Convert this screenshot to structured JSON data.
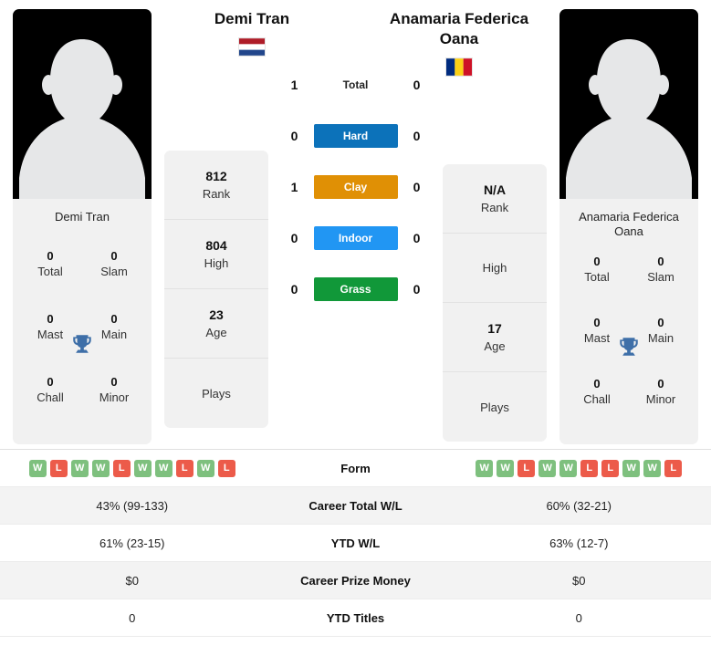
{
  "players": {
    "left": {
      "name": "Demi Tran",
      "card_name": "Demi Tran",
      "flag": "netherlands-flag",
      "flag_colors": [
        "#AE1C28",
        "#FFFFFF",
        "#21468B"
      ],
      "rank": "812",
      "rank_label": "Rank",
      "high": "804",
      "high_label": "High",
      "age": "23",
      "age_label": "Age",
      "plays": "",
      "plays_label": "Plays",
      "awards": [
        {
          "value": "0",
          "label": "Total"
        },
        {
          "value": "0",
          "label": "Slam"
        },
        {
          "value": "0",
          "label": "Mast"
        },
        {
          "value": "0",
          "label": "Main"
        },
        {
          "value": "0",
          "label": "Chall"
        },
        {
          "value": "0",
          "label": "Minor"
        }
      ],
      "form": [
        "W",
        "L",
        "W",
        "W",
        "L",
        "W",
        "W",
        "L",
        "W",
        "L"
      ],
      "career_total_wl": "43% (99-133)",
      "ytd_wl": "61% (23-15)",
      "career_prize_money": "$0",
      "ytd_titles": "0"
    },
    "right": {
      "name": "Anamaria Federica Oana",
      "card_name": "Anamaria Federica Oana",
      "flag": "romania-flag",
      "flag_colors": [
        "#002B7F",
        "#FCD116",
        "#CE1126"
      ],
      "rank": "N/A",
      "rank_label": "Rank",
      "high": "",
      "high_label": "High",
      "age": "17",
      "age_label": "Age",
      "plays": "",
      "plays_label": "Plays",
      "awards": [
        {
          "value": "0",
          "label": "Total"
        },
        {
          "value": "0",
          "label": "Slam"
        },
        {
          "value": "0",
          "label": "Mast"
        },
        {
          "value": "0",
          "label": "Main"
        },
        {
          "value": "0",
          "label": "Chall"
        },
        {
          "value": "0",
          "label": "Minor"
        }
      ],
      "form": [
        "W",
        "W",
        "L",
        "W",
        "W",
        "L",
        "L",
        "W",
        "W",
        "L"
      ],
      "career_total_wl": "60% (32-21)",
      "ytd_wl": "63% (12-7)",
      "career_prize_money": "$0",
      "ytd_titles": "0"
    }
  },
  "head_to_head": [
    {
      "label": "Total",
      "left": "1",
      "right": "0",
      "style": "plain",
      "color": ""
    },
    {
      "label": "Hard",
      "left": "0",
      "right": "0",
      "style": "surface",
      "color": "#0c72ba"
    },
    {
      "label": "Clay",
      "left": "1",
      "right": "0",
      "style": "surface",
      "color": "#e09005"
    },
    {
      "label": "Indoor",
      "left": "0",
      "right": "0",
      "style": "surface",
      "color": "#2196f3"
    },
    {
      "label": "Grass",
      "left": "0",
      "right": "0",
      "style": "surface",
      "color": "#119839"
    }
  ],
  "comparison_rows": [
    {
      "label": "Form",
      "type": "form"
    },
    {
      "label": "Career Total W/L",
      "type": "text",
      "key": "career_total_wl"
    },
    {
      "label": "YTD W/L",
      "type": "text",
      "key": "ytd_wl"
    },
    {
      "label": "Career Prize Money",
      "type": "text",
      "key": "career_prize_money"
    },
    {
      "label": "YTD Titles",
      "type": "text",
      "key": "ytd_titles"
    }
  ],
  "icons": {
    "trophy": "trophy-icon",
    "avatar": "avatar-placeholder-icon"
  },
  "colors": {
    "win": "#7ec07e",
    "loss": "#ec5b4a",
    "card_bg": "#f1f1f1",
    "row_alt": "#f3f3f3"
  }
}
